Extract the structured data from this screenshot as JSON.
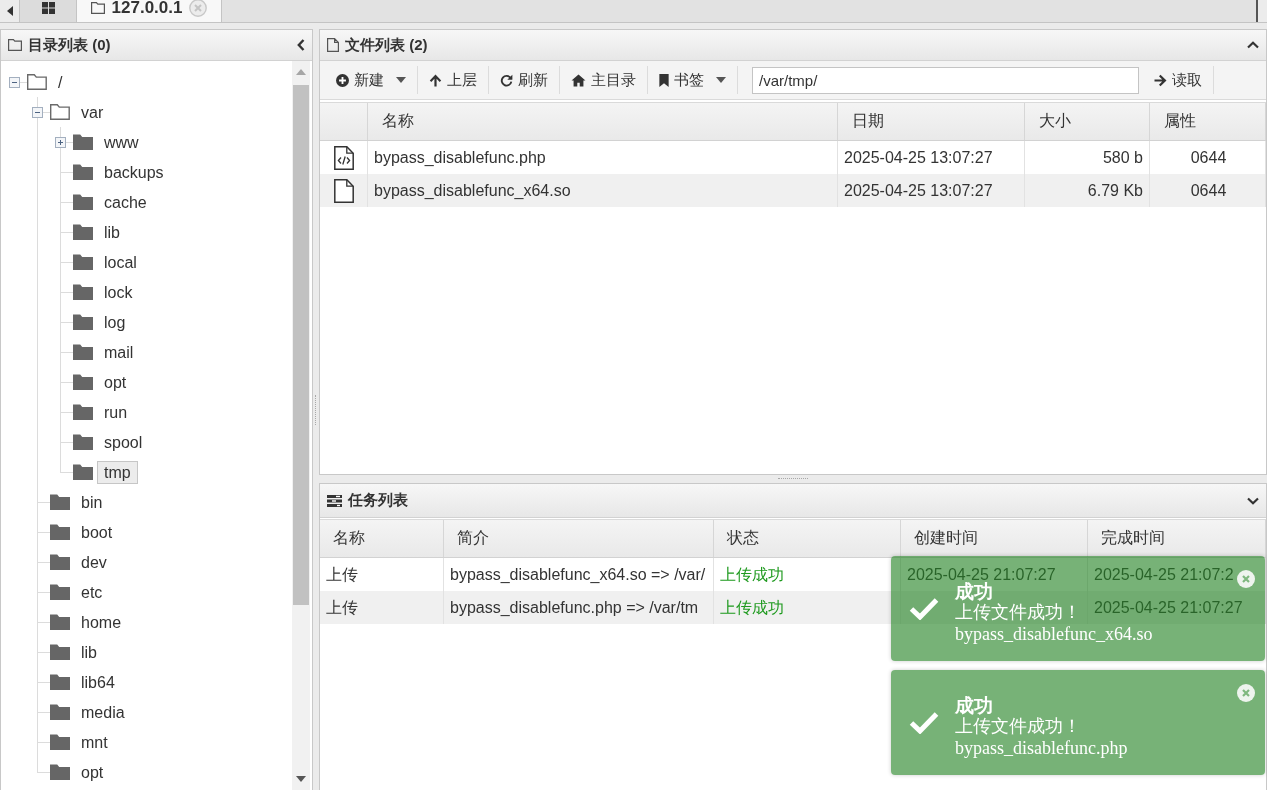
{
  "tabbar": {
    "tabs": [
      {
        "kind": "grid",
        "selected": false
      },
      {
        "kind": "site",
        "label": "127.0.0.1",
        "selected": true
      }
    ]
  },
  "dir_panel": {
    "title": "目录列表 (0)",
    "tree": [
      {
        "label": "/",
        "kind": "branch",
        "expanded": true,
        "selected": false,
        "children": [
          {
            "label": "var",
            "kind": "branch",
            "expanded": true,
            "selected": false,
            "children": [
              {
                "label": "www",
                "kind": "branch",
                "expanded": false,
                "selected": false
              },
              {
                "label": "backups",
                "kind": "leaf",
                "expanded": false,
                "selected": false
              },
              {
                "label": "cache",
                "kind": "leaf",
                "expanded": false,
                "selected": false
              },
              {
                "label": "lib",
                "kind": "leaf",
                "expanded": false,
                "selected": false
              },
              {
                "label": "local",
                "kind": "leaf",
                "expanded": false,
                "selected": false
              },
              {
                "label": "lock",
                "kind": "leaf",
                "expanded": false,
                "selected": false
              },
              {
                "label": "log",
                "kind": "leaf",
                "expanded": false,
                "selected": false
              },
              {
                "label": "mail",
                "kind": "leaf",
                "expanded": false,
                "selected": false
              },
              {
                "label": "opt",
                "kind": "leaf",
                "expanded": false,
                "selected": false
              },
              {
                "label": "run",
                "kind": "leaf",
                "expanded": false,
                "selected": false
              },
              {
                "label": "spool",
                "kind": "leaf",
                "expanded": false,
                "selected": false
              },
              {
                "label": "tmp",
                "kind": "leaf",
                "expanded": false,
                "selected": true
              }
            ]
          },
          {
            "label": "bin",
            "kind": "leaf",
            "expanded": false,
            "selected": false
          },
          {
            "label": "boot",
            "kind": "leaf",
            "expanded": false,
            "selected": false
          },
          {
            "label": "dev",
            "kind": "leaf",
            "expanded": false,
            "selected": false
          },
          {
            "label": "etc",
            "kind": "leaf",
            "expanded": false,
            "selected": false
          },
          {
            "label": "home",
            "kind": "leaf",
            "expanded": false,
            "selected": false
          },
          {
            "label": "lib",
            "kind": "leaf",
            "expanded": false,
            "selected": false
          },
          {
            "label": "lib64",
            "kind": "leaf",
            "expanded": false,
            "selected": false
          },
          {
            "label": "media",
            "kind": "leaf",
            "expanded": false,
            "selected": false
          },
          {
            "label": "mnt",
            "kind": "leaf",
            "expanded": false,
            "selected": false
          },
          {
            "label": "opt",
            "kind": "leaf",
            "expanded": false,
            "selected": false
          }
        ]
      }
    ]
  },
  "file_panel": {
    "title": "文件列表 (2)",
    "toolbar": {
      "buttons": [
        {
          "kind": "new",
          "label": "新建",
          "dropdown": true
        },
        {
          "kind": "up",
          "label": "上层",
          "dropdown": false
        },
        {
          "kind": "refresh",
          "label": "刷新",
          "dropdown": false
        },
        {
          "kind": "home",
          "label": "主目录",
          "dropdown": false
        },
        {
          "kind": "bookmarks",
          "label": "书签",
          "dropdown": true
        }
      ],
      "path": {
        "value": "/var/tmp/"
      },
      "read_button": {
        "label": "读取"
      }
    },
    "table": {
      "columns": [
        "名称",
        "日期",
        "大小",
        "属性"
      ],
      "rows": [
        {
          "kind": "code",
          "name": "bypass_disablefunc.php",
          "date": "2025-04-25 13:07:27",
          "size": "580 b",
          "mode": "0644"
        },
        {
          "kind": "file",
          "name": "bypass_disablefunc_x64.so",
          "date": "2025-04-25 13:07:27",
          "size": "6.79 Kb",
          "mode": "0644"
        }
      ]
    }
  },
  "task_panel": {
    "title": "任务列表",
    "table": {
      "columns": [
        "名称",
        "简介",
        "状态",
        "创建时间",
        "完成时间"
      ],
      "rows": [
        {
          "name": "上传",
          "summary": "bypass_disablefunc_x64.so => /var/",
          "status": "上传成功",
          "created": "2025-04-25 21:07:27",
          "finished": "2025-04-25 21:07:2"
        },
        {
          "name": "上传",
          "summary": "bypass_disablefunc.php => /var/tm",
          "status": "上传成功",
          "finished": "2025-04-25 21:07:27"
        }
      ]
    }
  },
  "notifications": [
    {
      "title": "成功",
      "message": "上传文件成功！",
      "detail": "bypass_disablefunc_x64.so"
    },
    {
      "title": "成功",
      "message": "上传文件成功！",
      "detail": "bypass_disablefunc.php"
    }
  ]
}
